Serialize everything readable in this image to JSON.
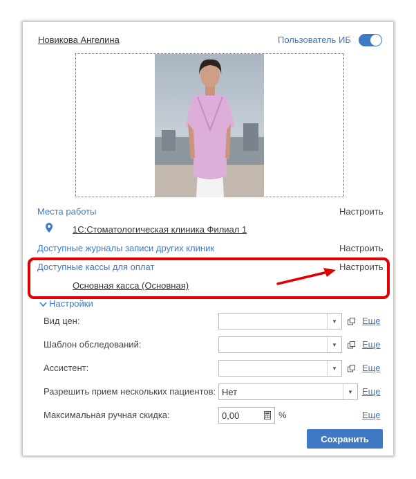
{
  "user": {
    "name": "Новикова Ангелина",
    "ib_user_label": "Пользователь ИБ",
    "ib_user_enabled": true
  },
  "workplaces": {
    "title": "Места работы",
    "configure": "Настроить",
    "items": [
      "1С:Стоматологическая клиника Филиал 1"
    ]
  },
  "journals": {
    "title": "Доступные журналы записи других клиник",
    "configure": "Настроить"
  },
  "cash": {
    "title": "Доступные кассы для оплат",
    "configure": "Настроить",
    "items": [
      "Основная касса (Основная)"
    ]
  },
  "settings": {
    "title": "Настройки",
    "price_type": {
      "label": "Вид цен:",
      "value": "",
      "more": "Еще"
    },
    "exam_template": {
      "label": "Шаблон обследований:",
      "value": "",
      "more": "Еще"
    },
    "assistant": {
      "label": "Ассистент:",
      "value": "",
      "more": "Еще"
    },
    "multi_patients": {
      "label": "Разрешить прием нескольких пациентов:",
      "value": "Нет",
      "more": "Еще"
    },
    "max_discount": {
      "label": "Максимальная ручная скидка:",
      "value": "0,00",
      "unit": "%",
      "more": "Еще"
    }
  },
  "save_label": "Сохранить",
  "colors": {
    "accent": "#3f79c4",
    "highlight": "#e00000"
  }
}
